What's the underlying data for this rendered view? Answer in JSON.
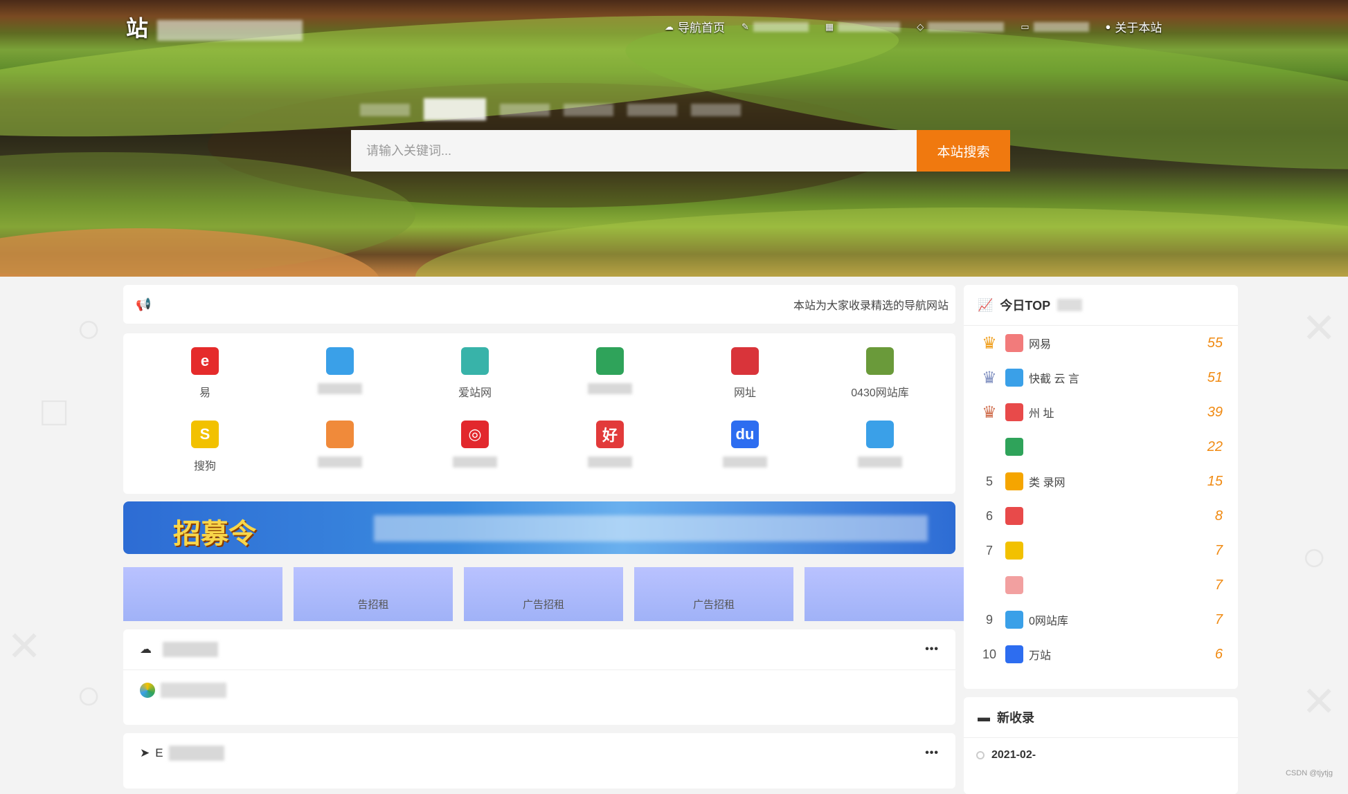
{
  "header": {
    "logo_text": "站",
    "nav": [
      {
        "label": "导航首页",
        "icon": "home-icon"
      },
      {
        "label": "",
        "icon": "pen-icon"
      },
      {
        "label": "",
        "icon": "grid-icon"
      },
      {
        "label": "",
        "icon": "tag-icon"
      },
      {
        "label": "",
        "icon": "monitor-icon"
      },
      {
        "label": "关于本站",
        "icon": "info-icon"
      }
    ]
  },
  "search": {
    "placeholder": "请输入关键词...",
    "button": "本站搜索"
  },
  "notice": {
    "text": "本站为大家收录精选的导航网站"
  },
  "sites": [
    {
      "name": "易",
      "color": "#e52b2b",
      "glyph": "e"
    },
    {
      "name": "",
      "color": "#3aa0e8",
      "glyph": ""
    },
    {
      "name": "爱站网",
      "color": "#38b3a9",
      "glyph": ""
    },
    {
      "name": "",
      "color": "#2fa35a",
      "glyph": ""
    },
    {
      "name": "网址",
      "color": "#d9343a",
      "glyph": ""
    },
    {
      "name": "0430网站库",
      "color": "#6a9a3a",
      "glyph": ""
    },
    {
      "name": "搜狗",
      "color": "#f2c100",
      "glyph": "S"
    },
    {
      "name": "",
      "color": "#f08a3a",
      "glyph": ""
    },
    {
      "name": "",
      "color": "#e2282d",
      "glyph": "◎"
    },
    {
      "name": "",
      "color": "#e23a3a",
      "glyph": "好"
    },
    {
      "name": "",
      "color": "#2d6df0",
      "glyph": "du"
    },
    {
      "name": "",
      "color": "#3aa0e8",
      "glyph": ""
    }
  ],
  "banner": {
    "title": "招募令"
  },
  "ads": [
    {
      "line1": "",
      "line2": ""
    },
    {
      "line1": "",
      "line2": "告招租"
    },
    {
      "line1": "",
      "line2": "广告招租"
    },
    {
      "line1": "",
      "line2": "广告招租"
    },
    {
      "line1": "",
      "line2": ""
    }
  ],
  "sections": [
    {
      "title": "",
      "icon": "cloud-icon",
      "more": "•••"
    },
    {
      "title": "E",
      "icon": "send-icon",
      "more": "•••"
    }
  ],
  "top_today": {
    "title": "今日TOP",
    "items": [
      {
        "no": "",
        "name": "网易",
        "count": "55",
        "crown": "gold"
      },
      {
        "no": "",
        "name": "快截 云 言",
        "count": "51",
        "crown": "silver"
      },
      {
        "no": "",
        "name": "州 址",
        "count": "39",
        "crown": "bronze"
      },
      {
        "no": "",
        "name": "",
        "count": "22",
        "crown": ""
      },
      {
        "no": "5",
        "name": "类 录网",
        "count": "15",
        "crown": ""
      },
      {
        "no": "6",
        "name": "",
        "count": "8",
        "crown": ""
      },
      {
        "no": "7",
        "name": "",
        "count": "7",
        "crown": ""
      },
      {
        "no": "",
        "name": "",
        "count": "7",
        "crown": ""
      },
      {
        "no": "9",
        "name": "0网站库",
        "count": "7",
        "crown": ""
      },
      {
        "no": "10",
        "name": "万站",
        "count": "6",
        "crown": ""
      }
    ]
  },
  "newest": {
    "title": "新收录",
    "date": "2021-02-"
  },
  "watermark": "CSDN @tjytjg"
}
